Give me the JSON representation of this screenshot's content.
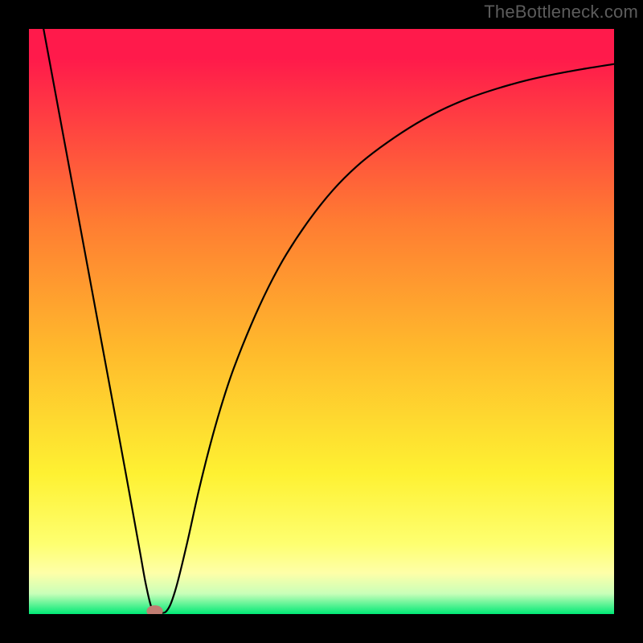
{
  "watermark": "TheBottleneck.com",
  "chart_data": {
    "type": "line",
    "title": "",
    "xlabel": "",
    "ylabel": "",
    "xlim": [
      0,
      100
    ],
    "ylim": [
      0,
      100
    ],
    "grid": false,
    "legend": false,
    "gradient_stops": [
      {
        "offset": 0.0,
        "color": "#ff1a4b"
      },
      {
        "offset": 0.05,
        "color": "#ff1a4b"
      },
      {
        "offset": 0.33,
        "color": "#ff7c32"
      },
      {
        "offset": 0.55,
        "color": "#ffba2c"
      },
      {
        "offset": 0.76,
        "color": "#fef132"
      },
      {
        "offset": 0.88,
        "color": "#feff70"
      },
      {
        "offset": 0.93,
        "color": "#feffa8"
      },
      {
        "offset": 0.965,
        "color": "#c9ffb9"
      },
      {
        "offset": 1.0,
        "color": "#00e976"
      }
    ],
    "frame": {
      "stroke": "#000000",
      "width": 36
    },
    "marker": {
      "x": 21.5,
      "y": 0.5,
      "color": "#c17d72",
      "rx": 1.4,
      "ry": 1.0
    },
    "series": [
      {
        "name": "bottleneck-curve",
        "color": "#000000",
        "width": 2.2,
        "x": [
          2.5,
          5,
          7.5,
          10,
          12.5,
          15,
          17.2,
          19,
          20,
          21,
          22,
          23.5,
          25,
          27,
          29,
          31,
          33,
          35,
          38,
          41,
          44,
          48,
          52,
          56,
          60,
          65,
          70,
          75,
          80,
          85,
          90,
          95,
          100
        ],
        "y": [
          100,
          86.5,
          73,
          59.5,
          46,
          32.5,
          20.5,
          10.5,
          5,
          1,
          0.5,
          0.5,
          4,
          12,
          21,
          29,
          36,
          42,
          49.5,
          56,
          61.5,
          67.5,
          72.5,
          76.5,
          79.7,
          83.1,
          85.9,
          88.1,
          89.8,
          91.2,
          92.3,
          93.2,
          94.0
        ]
      }
    ]
  }
}
